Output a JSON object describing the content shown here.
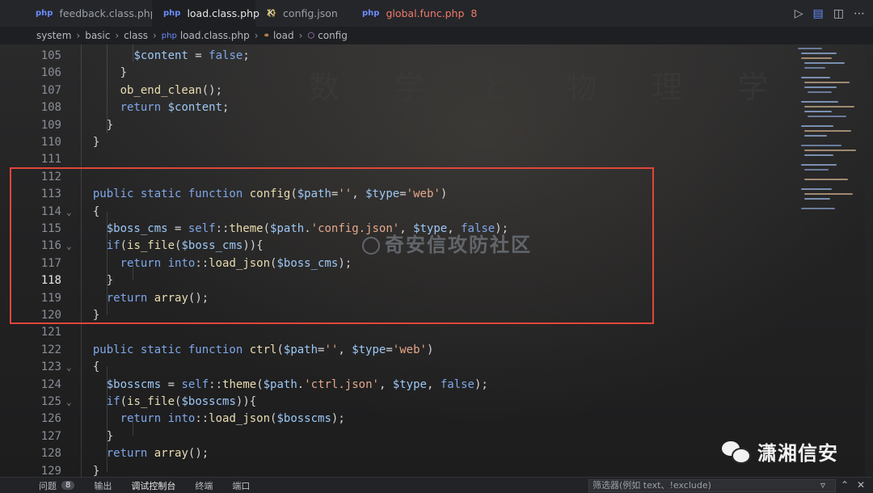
{
  "tabs": [
    {
      "label": "feedback.class.php",
      "icon": "php",
      "active": false
    },
    {
      "label": "load.class.php",
      "icon": "php",
      "active": true,
      "close": "✕"
    },
    {
      "label": "config.json",
      "icon": "json",
      "active": false
    },
    {
      "label": "global.func.php",
      "icon": "php",
      "active": false,
      "count": "8"
    }
  ],
  "breadcrumb": {
    "parts": [
      "system",
      "basic",
      "class",
      "load.class.php",
      "load",
      "config"
    ]
  },
  "activity": {
    "count": "8"
  },
  "background_text": "数 学 と 物 理 学",
  "watermark": "奇安信攻防社区",
  "brand": "潇湘信安",
  "panel": {
    "tabs": [
      "问题",
      "输出",
      "调试控制台",
      "终端",
      "端口"
    ],
    "problems_count": "8",
    "filter_placeholder": "筛选器(例如 text、!exclude)"
  }
}
